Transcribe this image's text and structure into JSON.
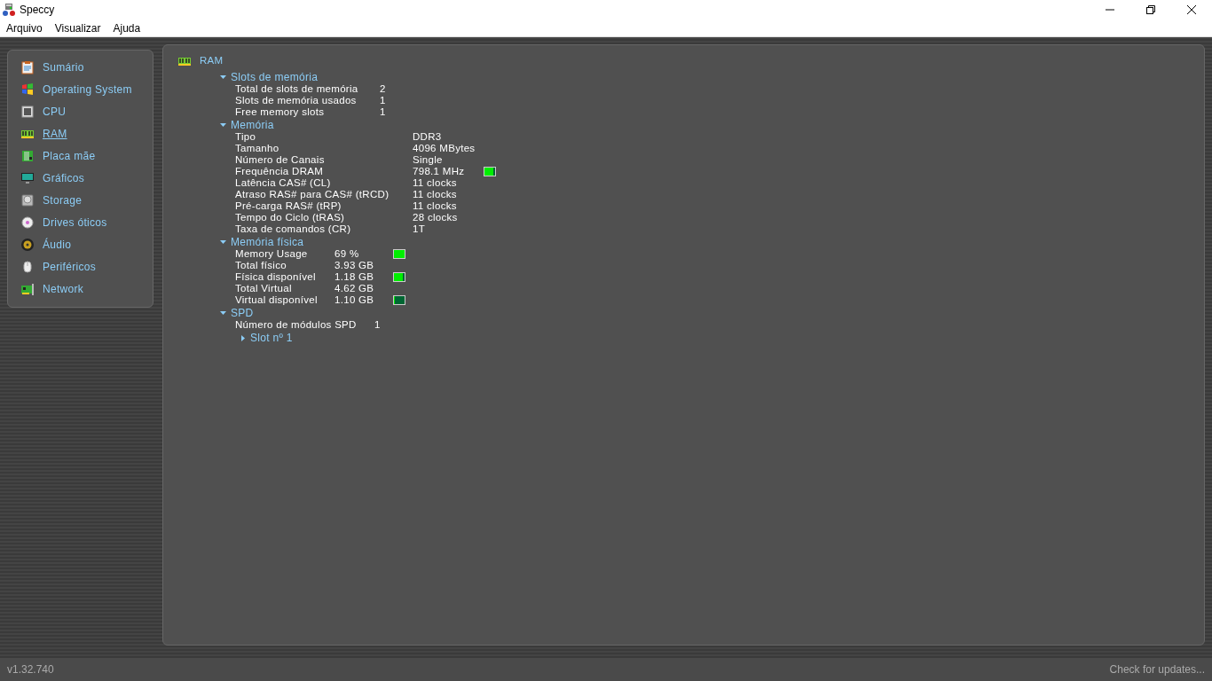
{
  "window": {
    "title": "Speccy"
  },
  "menu": [
    {
      "label": "Arquivo"
    },
    {
      "label": "Visualizar"
    },
    {
      "label": "Ajuda"
    }
  ],
  "sidebar": {
    "items": [
      {
        "label": "Sumário",
        "selected": false
      },
      {
        "label": "Operating System",
        "selected": false
      },
      {
        "label": "CPU",
        "selected": false
      },
      {
        "label": "RAM",
        "selected": true
      },
      {
        "label": "Placa mãe",
        "selected": false
      },
      {
        "label": "Gráficos",
        "selected": false
      },
      {
        "label": "Storage",
        "selected": false
      },
      {
        "label": "Drives óticos",
        "selected": false
      },
      {
        "label": "Áudio",
        "selected": false
      },
      {
        "label": "Periféricos",
        "selected": false
      },
      {
        "label": "Network",
        "selected": false
      }
    ]
  },
  "main": {
    "title": "RAM",
    "sections": [
      {
        "title": "Slots de memória",
        "expanded": true,
        "rows": [
          {
            "label": "Total de slots de memória",
            "value": "2"
          },
          {
            "label": "Slots de memória usados",
            "value": "1"
          },
          {
            "label": "Free memory slots",
            "value": "1"
          }
        ]
      },
      {
        "title": "Memória",
        "expanded": true,
        "rows": [
          {
            "label": "Tipo",
            "value": "DDR3"
          },
          {
            "label": "Tamanho",
            "value": "4096 MBytes"
          },
          {
            "label": "Número de Canais",
            "value": "Single"
          },
          {
            "label": "Frequência DRAM",
            "value": "798.1 MHz",
            "level": 0.85
          },
          {
            "label": "Latência CAS# (CL)",
            "value": "11 clocks"
          },
          {
            "label": "Atraso RAS# para CAS# (tRCD)",
            "value": "11 clocks"
          },
          {
            "label": "Pré-carga RAS# (tRP)",
            "value": "11 clocks"
          },
          {
            "label": "Tempo do Ciclo (tRAS)",
            "value": "28 clocks"
          },
          {
            "label": "Taxa de comandos (CR)",
            "value": "1T"
          }
        ]
      },
      {
        "title": "Memória física",
        "expanded": true,
        "rows": [
          {
            "label": "Memory Usage",
            "value": "69 %",
            "level": 1
          },
          {
            "label": "Total físico",
            "value": "3.93 GB"
          },
          {
            "label": "Física disponível",
            "value": "1.18 GB",
            "level": 0.8
          },
          {
            "label": "Total Virtual",
            "value": "4.62 GB"
          },
          {
            "label": "Virtual disponível",
            "value": "1.10 GB",
            "level": 0.1
          }
        ]
      },
      {
        "title": "SPD",
        "expanded": true,
        "rows": [
          {
            "label": "Número de módulos SPD",
            "value": "1"
          }
        ],
        "children": [
          {
            "title": "Slot nº 1",
            "expanded": false
          }
        ]
      }
    ]
  },
  "status_bar": {
    "version": "v1.32.740",
    "update_link": "Check for updates..."
  }
}
